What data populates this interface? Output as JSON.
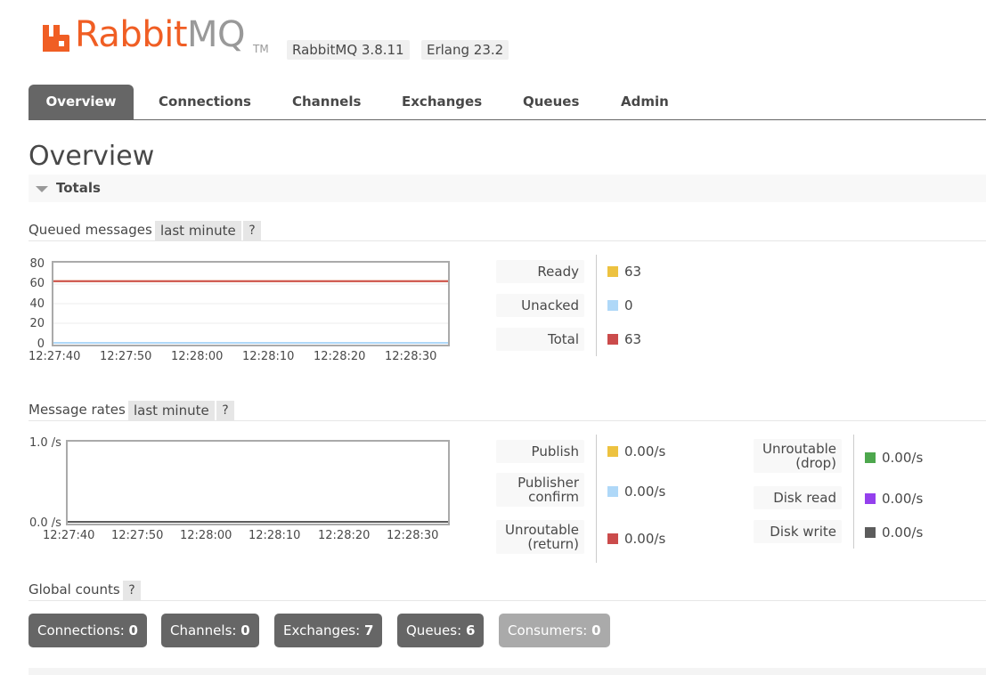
{
  "header": {
    "logo_text_rabbit": "Rabbit",
    "logo_text_mq": "MQ",
    "logo_tm": "TM",
    "version": "RabbitMQ 3.8.11",
    "erlang": "Erlang 23.2",
    "colors": {
      "brand": "#f05e24",
      "mq": "#999999"
    }
  },
  "nav": {
    "tabs": [
      {
        "label": "Overview",
        "active": true
      },
      {
        "label": "Connections",
        "active": false
      },
      {
        "label": "Channels",
        "active": false
      },
      {
        "label": "Exchanges",
        "active": false
      },
      {
        "label": "Queues",
        "active": false
      },
      {
        "label": "Admin",
        "active": false
      }
    ]
  },
  "page_title": "Overview",
  "totals": {
    "label": "Totals",
    "toggle_icon": "triangle-down-icon"
  },
  "queued": {
    "label": "Queued messages",
    "range": "last minute",
    "help": "?",
    "y_ticks": [
      "80",
      "60",
      "40",
      "20",
      "0"
    ],
    "x_ticks": [
      "12:27:40",
      "12:27:50",
      "12:28:00",
      "12:28:10",
      "12:28:20",
      "12:28:30"
    ],
    "stats": [
      {
        "label": "Ready",
        "value": "63",
        "color": "#edc240"
      },
      {
        "label": "Unacked",
        "value": "0",
        "color": "#afd8f8"
      },
      {
        "label": "Total",
        "value": "63",
        "color": "#cb4b4b"
      }
    ]
  },
  "rates": {
    "label": "Message rates",
    "range": "last minute",
    "help": "?",
    "y_ticks": [
      "1.0 /s",
      "0.0 /s"
    ],
    "x_ticks": [
      "12:27:40",
      "12:27:50",
      "12:28:00",
      "12:28:10",
      "12:28:20",
      "12:28:30"
    ],
    "stats_left": [
      {
        "label_1": "Publish",
        "label_2": "",
        "value": "0.00/s",
        "color": "#edc240"
      },
      {
        "label_1": "Publisher",
        "label_2": "confirm",
        "value": "0.00/s",
        "color": "#afd8f8"
      },
      {
        "label_1": "Unroutable",
        "label_2": "(return)",
        "value": "0.00/s",
        "color": "#cb4b4b"
      }
    ],
    "stats_right": [
      {
        "label_1": "Unroutable",
        "label_2": "(drop)",
        "value": "0.00/s",
        "color": "#4da74d"
      },
      {
        "label_1": "Disk read",
        "label_2": "",
        "value": "0.00/s",
        "color": "#9440ed"
      },
      {
        "label_1": "Disk write",
        "label_2": "",
        "value": "0.00/s",
        "color": "#5c5c5c"
      }
    ]
  },
  "global_counts": {
    "label": "Global counts",
    "help": "?",
    "items": [
      {
        "label": "Connections:",
        "value": "0"
      },
      {
        "label": "Channels:",
        "value": "0"
      },
      {
        "label": "Exchanges:",
        "value": "7"
      },
      {
        "label": "Queues:",
        "value": "6"
      },
      {
        "label": "Consumers:",
        "value": "0"
      }
    ]
  },
  "chart_data": [
    {
      "type": "line",
      "x": [
        "12:27:40",
        "12:27:50",
        "12:28:00",
        "12:28:10",
        "12:28:20",
        "12:28:30"
      ],
      "series": [
        {
          "name": "Ready",
          "values": [
            63,
            63,
            63,
            63,
            63,
            63
          ],
          "color": "#edc240"
        },
        {
          "name": "Unacked",
          "values": [
            0,
            0,
            0,
            0,
            0,
            0
          ],
          "color": "#afd8f8"
        },
        {
          "name": "Total",
          "values": [
            63,
            63,
            63,
            63,
            63,
            63
          ],
          "color": "#cb4b4b"
        }
      ],
      "ylim": [
        0,
        80
      ],
      "grid": true
    },
    {
      "type": "line",
      "x": [
        "12:27:40",
        "12:27:50",
        "12:28:00",
        "12:28:10",
        "12:28:20",
        "12:28:30"
      ],
      "series": [
        {
          "name": "Publish",
          "values": [
            0,
            0,
            0,
            0,
            0,
            0
          ],
          "color": "#edc240"
        },
        {
          "name": "Publisher confirm",
          "values": [
            0,
            0,
            0,
            0,
            0,
            0
          ],
          "color": "#afd8f8"
        },
        {
          "name": "Unroutable (return)",
          "values": [
            0,
            0,
            0,
            0,
            0,
            0
          ],
          "color": "#cb4b4b"
        },
        {
          "name": "Unroutable (drop)",
          "values": [
            0,
            0,
            0,
            0,
            0,
            0
          ],
          "color": "#4da74d"
        },
        {
          "name": "Disk read",
          "values": [
            0,
            0,
            0,
            0,
            0,
            0
          ],
          "color": "#9440ed"
        },
        {
          "name": "Disk write",
          "values": [
            0,
            0,
            0,
            0,
            0,
            0
          ],
          "color": "#5c5c5c"
        }
      ],
      "ylim": [
        0,
        1.0
      ],
      "grid": false
    }
  ]
}
